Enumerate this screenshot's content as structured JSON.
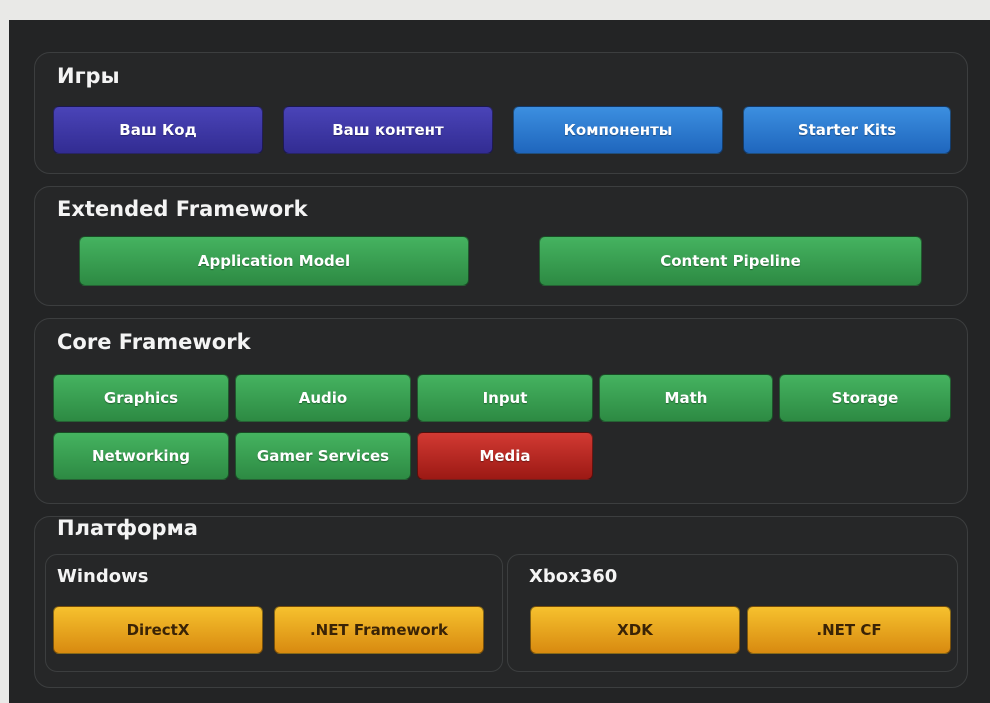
{
  "layers": {
    "games": {
      "title": "Игры",
      "items": [
        "Ваш Код",
        "Ваш контент",
        "Компоненты",
        "Starter Kits"
      ]
    },
    "extended": {
      "title": "Extended Framework",
      "items": [
        "Application Model",
        "Content Pipeline"
      ]
    },
    "core": {
      "title": "Core Framework",
      "items": [
        "Graphics",
        "Audio",
        "Input",
        "Math",
        "Storage",
        "Networking",
        "Gamer Services",
        "Media"
      ]
    },
    "platform": {
      "title": "Платформа",
      "windows": {
        "title": "Windows",
        "items": [
          "DirectX",
          ".NET Framework"
        ]
      },
      "xbox": {
        "title": "Xbox360",
        "items": [
          "XDK",
          ".NET CF"
        ]
      }
    }
  },
  "colors": {
    "games_code": "#3a35a5",
    "games_components": "#2e7bd0",
    "framework": "#39a052",
    "media": "#b72823",
    "platform": "#efa81f",
    "background": "#232425"
  }
}
